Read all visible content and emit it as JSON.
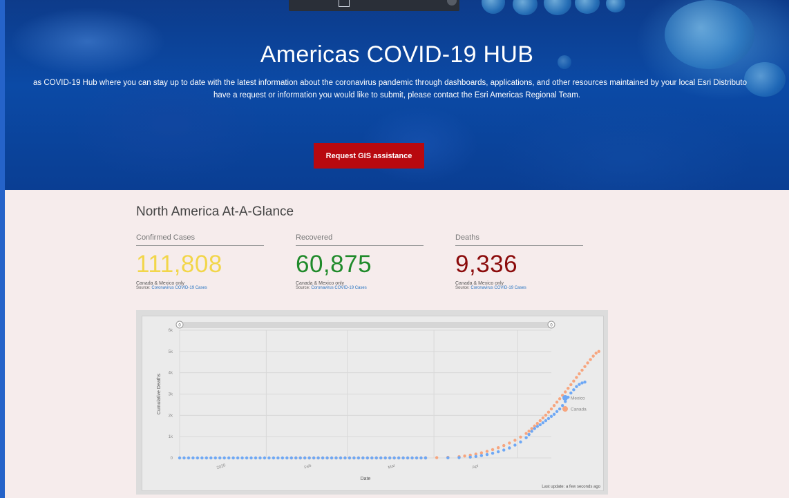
{
  "hero": {
    "title": "Americas COVID-19 HUB",
    "desc_line1": "as COVID-19 Hub where you can stay up to date with the latest information about the coronavirus pandemic through dashboards, applications, and other resources maintained by your local Esri Distributo",
    "desc_line2": "have a request or information you would like to submit, please contact the Esri Americas Regional Team.",
    "button_label": "Request GIS assistance",
    "button_color": "#b8090f"
  },
  "section": {
    "title": "North America At-A-Glance"
  },
  "stats": [
    {
      "label": "Confirmed Cases",
      "value": "111,808",
      "note": "Canada & Mexico only",
      "source_prefix": "Source: ",
      "source_link": "Coronavirus COVID-19 Cases",
      "color": "#f2d64a"
    },
    {
      "label": "Recovered",
      "value": "60,875",
      "note": "Canada & Mexico only",
      "source_prefix": "Source: ",
      "source_link": "Coronavirus COVID-19 Cases",
      "color": "#1f8a2a"
    },
    {
      "label": "Deaths",
      "value": "9,336",
      "note": "Canada & Mexico only",
      "source_prefix": "Source: ",
      "source_link": "Coronavirus COVID-19 Cases",
      "color": "#8b0b0b"
    }
  ],
  "chart_data": {
    "type": "scatter",
    "xlabel": "Date",
    "ylabel": "Cumulative Deaths",
    "x_tick_labels": [
      "2020",
      "Feb",
      "Mar",
      "Apr"
    ],
    "y_tick_labels": [
      "0",
      "1k",
      "2k",
      "3k",
      "4k",
      "5k",
      "6k"
    ],
    "ylim": [
      0,
      6000
    ],
    "xlim_days": [
      0,
      133
    ],
    "grid": true,
    "legend_position": "right",
    "slider_handles": [
      "0",
      "0"
    ],
    "last_update": "Last update: a few seconds ago",
    "series": [
      {
        "name": "Mexico",
        "color": "#6ea8f5",
        "points": [
          [
            0,
            0
          ],
          [
            8,
            0
          ],
          [
            16,
            0
          ],
          [
            24,
            0
          ],
          [
            32,
            0
          ],
          [
            40,
            0
          ],
          [
            48,
            0
          ],
          [
            56,
            0
          ],
          [
            64,
            0
          ],
          [
            72,
            0
          ],
          [
            80,
            0
          ],
          [
            88,
            0
          ],
          [
            96,
            5
          ],
          [
            100,
            15
          ],
          [
            104,
            40
          ],
          [
            106,
            70
          ],
          [
            108,
            110
          ],
          [
            110,
            160
          ],
          [
            112,
            220
          ],
          [
            114,
            290
          ],
          [
            116,
            370
          ],
          [
            118,
            470
          ],
          [
            120,
            600
          ],
          [
            122,
            750
          ],
          [
            124,
            950
          ],
          [
            125,
            1100
          ],
          [
            126,
            1250
          ],
          [
            127,
            1380
          ],
          [
            128,
            1480
          ],
          [
            129,
            1560
          ],
          [
            130,
            1650
          ],
          [
            131,
            1750
          ],
          [
            132,
            1850
          ],
          [
            133,
            1950
          ],
          [
            134,
            2050
          ],
          [
            135,
            2180
          ],
          [
            136,
            2300
          ],
          [
            137,
            2460
          ],
          [
            138,
            2650
          ],
          [
            139,
            2850
          ],
          [
            140,
            3050
          ],
          [
            141,
            3200
          ],
          [
            142,
            3350
          ],
          [
            143,
            3450
          ],
          [
            144,
            3520
          ],
          [
            145,
            3560
          ]
        ]
      },
      {
        "name": "Canada",
        "color": "#f7a57e",
        "points": [
          [
            40,
            0
          ],
          [
            48,
            0
          ],
          [
            56,
            0
          ],
          [
            64,
            0
          ],
          [
            72,
            0
          ],
          [
            80,
            0
          ],
          [
            88,
            5
          ],
          [
            92,
            15
          ],
          [
            96,
            30
          ],
          [
            100,
            60
          ],
          [
            102,
            90
          ],
          [
            104,
            130
          ],
          [
            106,
            180
          ],
          [
            108,
            240
          ],
          [
            110,
            310
          ],
          [
            112,
            390
          ],
          [
            114,
            480
          ],
          [
            116,
            580
          ],
          [
            118,
            700
          ],
          [
            120,
            830
          ],
          [
            122,
            980
          ],
          [
            124,
            1150
          ],
          [
            125,
            1260
          ],
          [
            126,
            1380
          ],
          [
            127,
            1500
          ],
          [
            128,
            1620
          ],
          [
            129,
            1750
          ],
          [
            130,
            1880
          ],
          [
            131,
            2010
          ],
          [
            132,
            2150
          ],
          [
            133,
            2300
          ],
          [
            134,
            2460
          ],
          [
            135,
            2620
          ],
          [
            136,
            2780
          ],
          [
            137,
            2940
          ],
          [
            138,
            3100
          ],
          [
            139,
            3270
          ],
          [
            140,
            3440
          ],
          [
            141,
            3610
          ],
          [
            142,
            3780
          ],
          [
            143,
            3950
          ],
          [
            144,
            4120
          ],
          [
            145,
            4290
          ],
          [
            146,
            4460
          ],
          [
            147,
            4620
          ],
          [
            148,
            4780
          ],
          [
            149,
            4920
          ],
          [
            150,
            5000
          ]
        ]
      }
    ]
  }
}
